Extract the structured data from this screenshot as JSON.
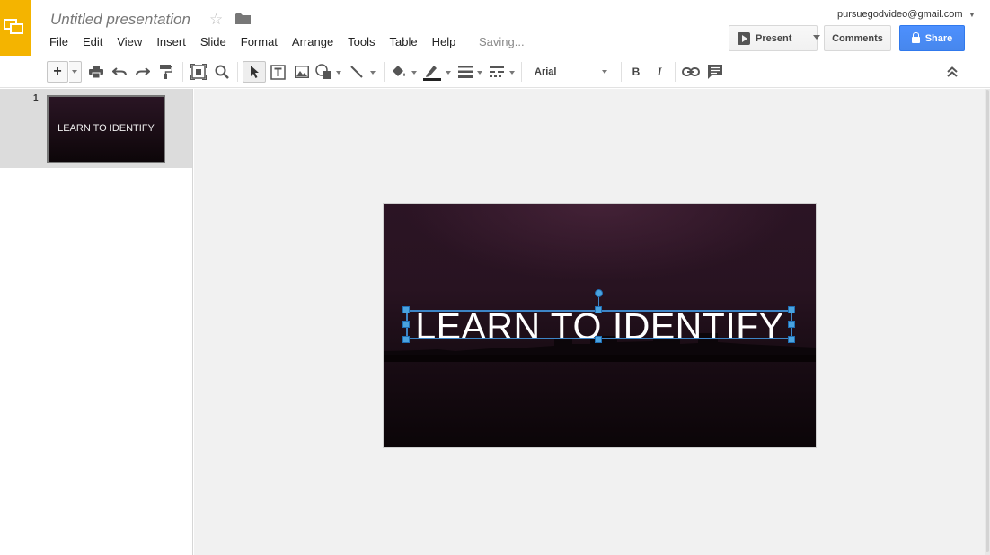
{
  "app": {
    "logo_icon": "slides-logo-icon",
    "accent_color": "#f4b400"
  },
  "header": {
    "doc_title": "Untitled presentation",
    "star_icon": "star-icon",
    "folder_icon": "folder-icon",
    "save_status": "Saving...",
    "account_email": "pursuegodvideo@gmail.com"
  },
  "menu": [
    "File",
    "Edit",
    "View",
    "Insert",
    "Slide",
    "Format",
    "Arrange",
    "Tools",
    "Table",
    "Help"
  ],
  "buttons": {
    "present": "Present",
    "comments": "Comments",
    "share": "Share",
    "share_color": "#4d90fe"
  },
  "toolbar": {
    "new_slide": "+",
    "font": "Arial",
    "bold": "B",
    "italic": "I",
    "icons": [
      "plus-icon",
      "print-icon",
      "undo-icon",
      "redo-icon",
      "paint-format-icon",
      "zoom-fit-icon",
      "zoom-icon",
      "select-arrow-icon",
      "text-box-icon",
      "image-icon",
      "shape-icon",
      "line-icon",
      "fill-color-icon",
      "border-color-icon",
      "border-weight-icon",
      "border-dash-icon",
      "bold-icon",
      "italic-icon",
      "link-icon",
      "comment-icon",
      "collapse-icon"
    ]
  },
  "filmstrip": {
    "slides": [
      {
        "number": "1",
        "text": "LEARN TO IDENTIFY"
      }
    ]
  },
  "slide": {
    "title": "LEARN TO IDENTIFY",
    "title_color": "#ffffff",
    "selection_color": "#3d85c6"
  }
}
